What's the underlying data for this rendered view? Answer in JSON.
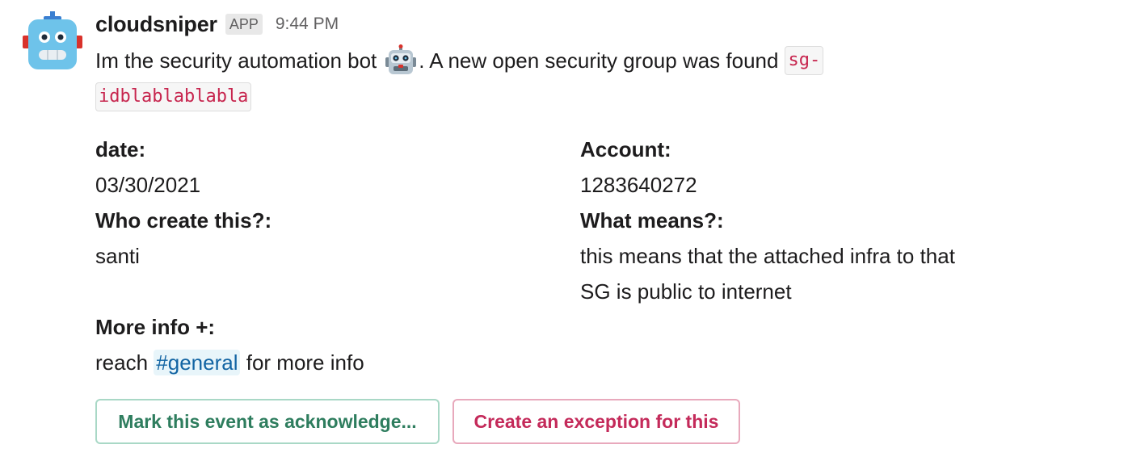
{
  "message": {
    "username": "cloudsniper",
    "badge": "APP",
    "time": "9:44 PM",
    "text_before_emoji": "Im the security automation bot",
    "emoji": "robot-face",
    "text_after_emoji": ". A new open security group was found",
    "code_part1": "sg-",
    "code_part2": "idblablablabla"
  },
  "fields": {
    "date_label": "date:",
    "date_value": "03/30/2021",
    "account_label": "Account:",
    "account_value": "1283640272",
    "who_label": "Who create this?:",
    "who_value": "santi",
    "what_label": "What means?:",
    "what_value_line1": "this means that the attached infra to that",
    "what_value_line2": "SG is public to internet",
    "more_label": "More info +:",
    "more_prefix": "reach",
    "more_channel": "#general",
    "more_suffix": "for more info"
  },
  "buttons": {
    "acknowledge": "Mark this event as acknowledge...",
    "exception": "Create an exception for this"
  },
  "colors": {
    "acknowledge_text": "#2e7d5e",
    "exception_text": "#c42a5a",
    "channel_link": "#1264a3",
    "code_text": "#c7254e"
  }
}
